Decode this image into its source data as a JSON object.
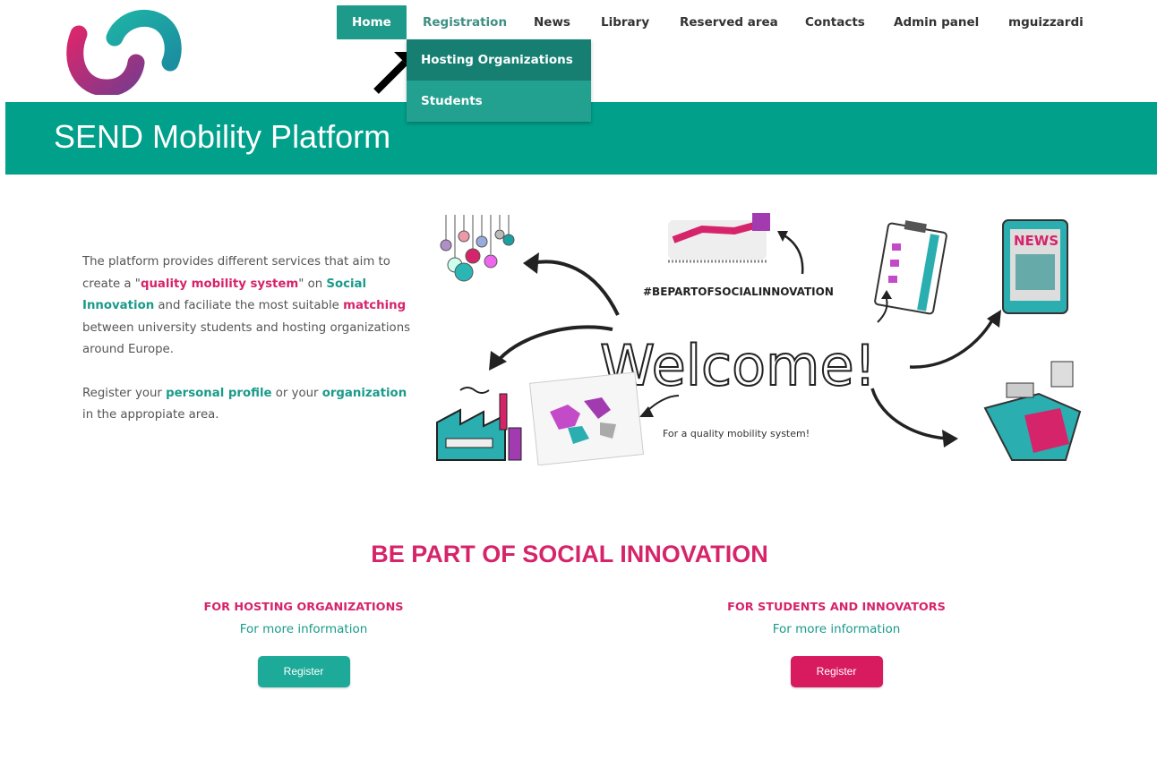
{
  "nav": {
    "items": [
      {
        "label": "Home"
      },
      {
        "label": "Registration"
      },
      {
        "label": "News"
      },
      {
        "label": "Library"
      },
      {
        "label": "Reserved area"
      },
      {
        "label": "Contacts"
      },
      {
        "label": "Admin panel"
      },
      {
        "label": "mguizzardi"
      }
    ],
    "active": "Home",
    "dropdown": [
      "Hosting Organizations",
      "Students"
    ]
  },
  "banner": {
    "title": "SEND Mobility Platform"
  },
  "intro": {
    "p1_a": "The platform provides different services that aim to create a \"",
    "p1_b": "quality mobility system",
    "p1_c": "\" on ",
    "p1_d": "Social Innovation",
    "p1_e": " and faciliate the most suitable ",
    "p1_f": "matching",
    "p1_g": " between university students and hosting organizations around Europe.",
    "p2_a": "Register your ",
    "p2_b": "personal profile",
    "p2_c": " or your ",
    "p2_d": "organization",
    "p2_e": " in the appropiate area."
  },
  "illustration": {
    "hashtag": "#BEPARTOFSOCIALINNOVATION",
    "welcome": "Welcome!",
    "tagline": "For a quality mobility system!",
    "news_label": "NEWS"
  },
  "cta": {
    "title": "BE PART OF SOCIAL INNOVATION",
    "left": {
      "heading": "FOR HOSTING ORGANIZATIONS",
      "sub": "For more information",
      "button": "Register"
    },
    "right": {
      "heading": "FOR STUDENTS AND INNOVATORS",
      "sub": "For more information",
      "button": "Register"
    }
  },
  "colors": {
    "teal": "#00a08a",
    "pink": "#d6246a",
    "logo_teal": "#1fa9a0",
    "logo_pink": "#d7276d"
  }
}
